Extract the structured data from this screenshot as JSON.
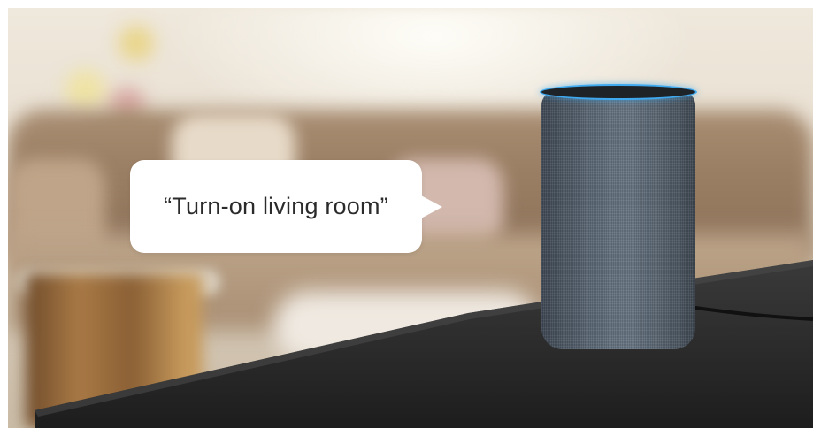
{
  "scene": {
    "description_icon": "smart-speaker-icon"
  },
  "speech_bubble": {
    "text": "“Turn-on living room”"
  },
  "colors": {
    "speaker_ring": "#3fa9f0",
    "speaker_fabric": "#5d6a77",
    "bubble_background": "#ffffff",
    "bubble_text": "#2b2b2b"
  }
}
